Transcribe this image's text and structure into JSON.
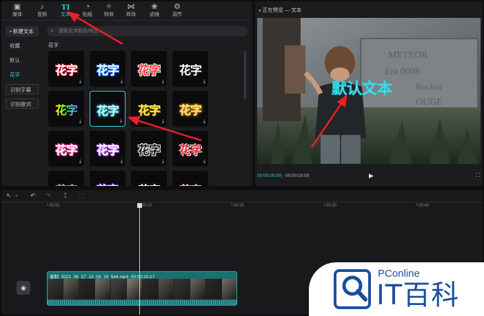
{
  "toolbar": {
    "tools": [
      {
        "name": "media",
        "label": "媒体",
        "icon": "▣"
      },
      {
        "name": "audio",
        "label": "音频",
        "icon": "♪"
      },
      {
        "name": "text",
        "label": "文本",
        "icon": "TI"
      },
      {
        "name": "sticker",
        "label": "贴纸",
        "icon": "◔"
      },
      {
        "name": "effects",
        "label": "特效",
        "icon": "✧"
      },
      {
        "name": "transition",
        "label": "转场",
        "icon": "⋈"
      },
      {
        "name": "filter",
        "label": "滤镜",
        "icon": "❀"
      },
      {
        "name": "adjust",
        "label": "调节",
        "icon": "⚙"
      }
    ],
    "active": "text"
  },
  "sidebar": {
    "items": [
      {
        "label": "• 新建文本"
      },
      {
        "label": "收藏"
      },
      {
        "label": "默认"
      },
      {
        "label": "花字"
      },
      {
        "label": "识别字幕"
      },
      {
        "label": "识别歌词"
      }
    ],
    "active": "花字"
  },
  "search": {
    "placeholder": "搜索花字颜色/样式"
  },
  "section": {
    "title": "花字"
  },
  "tiles": {
    "text": "花字",
    "download_icon": "⤓",
    "count": 16,
    "selected_index": 5
  },
  "preview": {
    "title": "正在预览 — 文本",
    "overlay_text": "默认文本",
    "engraving": [
      "METEOR",
      "Era 0008",
      "Rockin",
      "OUGE"
    ],
    "time_current": "00:00:00:00",
    "time_separator": "|",
    "time_total": "00:00:03:00",
    "play_icon": "▶",
    "fullscreen_icon": "⛶"
  },
  "timeline": {
    "tools": {
      "select": "↖",
      "select_menu": "⌄",
      "undo": "↶",
      "redo": "↷",
      "split": "⌶",
      "delete": "⬚"
    },
    "ruler": [
      "00:00",
      "00:10",
      "00:20",
      "00:30",
      "00:40"
    ],
    "track_icon": "◉",
    "clip": {
      "filename": "录制_2021_06_27_13_03_29_544.mp4",
      "duration": "00:00:20:17"
    }
  },
  "watermark": {
    "brand": "PConline",
    "name": "IT百科"
  },
  "colors": {
    "accent": "#2fd0e0",
    "annotation_arrow": "#e8202a",
    "brand": "#1a4f9e"
  }
}
